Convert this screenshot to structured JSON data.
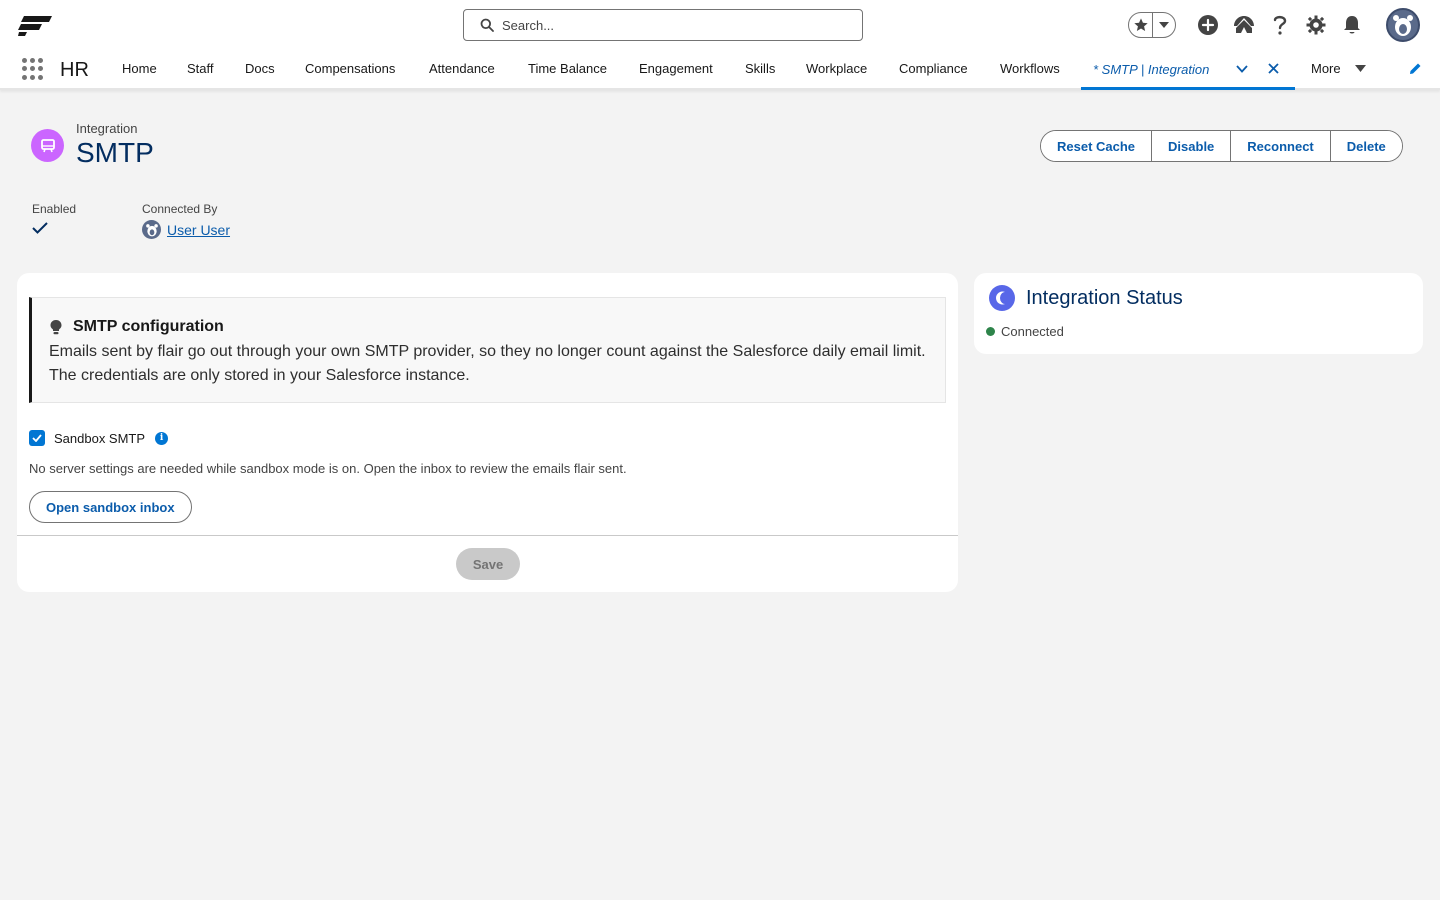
{
  "header": {
    "search_placeholder": "Search...",
    "icons": [
      "favorites-star-icon",
      "favorites-dropdown-icon",
      "add-icon",
      "trailhead-icon",
      "help-icon",
      "setup-gear-icon",
      "notifications-bell-icon",
      "user-avatar"
    ]
  },
  "nav": {
    "app_name": "HR",
    "items": [
      "Home",
      "Staff",
      "Docs",
      "Compensations",
      "Attendance",
      "Time Balance",
      "Engagement",
      "Skills",
      "Workplace",
      "Compliance",
      "Workflows"
    ],
    "active_tab": "* SMTP | Integration",
    "more_label": "More"
  },
  "record": {
    "type": "Integration",
    "title": "SMTP",
    "actions": [
      "Reset Cache",
      "Disable",
      "Reconnect",
      "Delete"
    ],
    "fields": {
      "enabled_label": "Enabled",
      "enabled_checked": true,
      "connected_by_label": "Connected By",
      "connected_by_value": "User User"
    }
  },
  "config": {
    "callout_title": "SMTP configuration",
    "callout_body": "Emails sent by flair go out through your own SMTP provider, so they no longer count against the Salesforce daily email limit. The credentials are only stored in your Salesforce instance.",
    "sandbox_label": "Sandbox SMTP",
    "sandbox_checked": true,
    "help_text": "No server settings are needed while sandbox mode is on. Open the inbox to review the emails flair sent.",
    "open_inbox_label": "Open sandbox inbox",
    "save_label": "Save"
  },
  "status": {
    "title": "Integration Status",
    "value": "Connected",
    "color": "#2e844a"
  },
  "colors": {
    "brand": "#0176d3",
    "link": "#0b5cab",
    "title": "#032d60",
    "record_icon": "#cb65ff",
    "status_icon": "#5867e8"
  }
}
